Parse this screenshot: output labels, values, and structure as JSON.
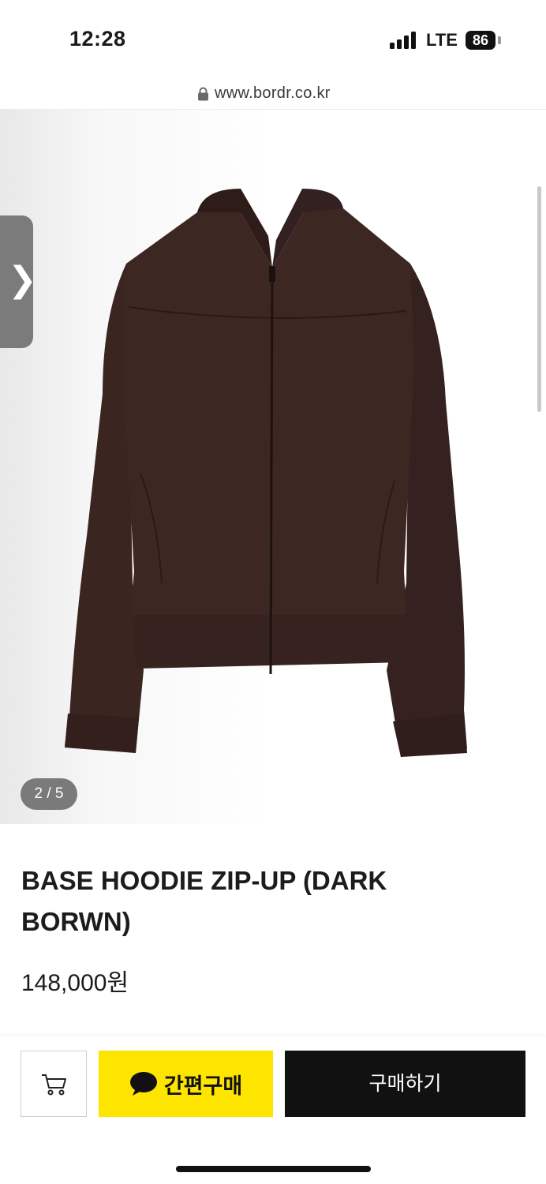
{
  "status_bar": {
    "time": "12:28",
    "network": "LTE",
    "battery": "86"
  },
  "browser": {
    "url": "www.bordr.co.kr"
  },
  "gallery": {
    "pager": "2 / 5",
    "current": 2,
    "total": 5
  },
  "product": {
    "title": "BASE HOODIE ZIP-UP (DARK BORWN)",
    "price": "148,000원",
    "color_hex": "#3b2520"
  },
  "actions": {
    "cart_icon": "cart-icon",
    "quick_buy_label": "간편구매",
    "quick_buy_icon": "talk-bubble-icon",
    "buy_now_label": "구매하기"
  },
  "colors": {
    "accent_yellow": "#fde500",
    "button_black": "#111111"
  }
}
